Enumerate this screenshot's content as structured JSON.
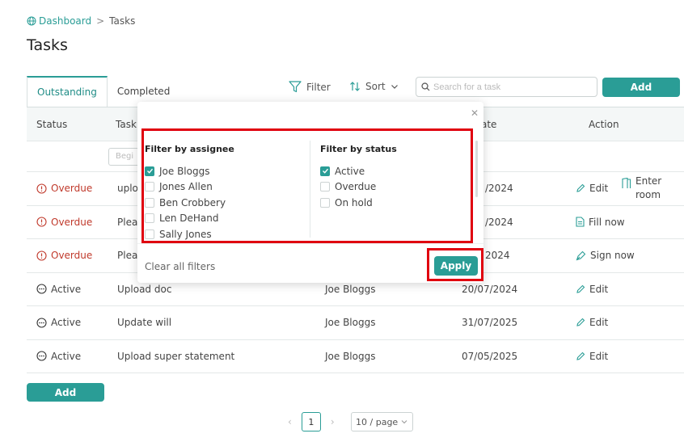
{
  "breadcrumb": {
    "home": "Dashboard",
    "separator": ">",
    "current": "Tasks"
  },
  "page": {
    "title": "Tasks"
  },
  "tabs": [
    {
      "label": "Outstanding"
    },
    {
      "label": "Completed"
    }
  ],
  "toolbar": {
    "filter_label": "Filter",
    "sort_label": "Sort",
    "search_placeholder": "Search for a task",
    "add_label": "Add"
  },
  "table": {
    "headers": {
      "status": "Status",
      "task": "Task",
      "date": "ate",
      "action": "Action"
    },
    "filter_placeholder": "Begi",
    "rows": [
      {
        "status": "Overdue",
        "task": "uploc",
        "assignee": "",
        "date": "/2024",
        "action": "Edit",
        "action2": "Enter room"
      },
      {
        "status": "Overdue",
        "task": "Pleas",
        "assignee": "",
        "date": "/2024",
        "action": "Fill now",
        "action2": ""
      },
      {
        "status": "Overdue",
        "task": "Pleas",
        "assignee": "",
        "date": "2024",
        "action": "Sign now",
        "action2": ""
      },
      {
        "status": "Active",
        "task": "Upload doc",
        "assignee": "Joe Bloggs",
        "date": "20/07/2024",
        "action": "Edit",
        "action2": ""
      },
      {
        "status": "Active",
        "task": "Update will",
        "assignee": "Joe Bloggs",
        "date": "31/07/2025",
        "action": "Edit",
        "action2": ""
      },
      {
        "status": "Active",
        "task": "Upload super statement",
        "assignee": "Joe Bloggs",
        "date": "07/05/2025",
        "action": "Edit",
        "action2": ""
      }
    ]
  },
  "bottom": {
    "add_label": "Add"
  },
  "pagination": {
    "current_page": "1",
    "page_size": "10 / page"
  },
  "filter_popup": {
    "assignee_title": "Filter by assignee",
    "assignees": [
      {
        "label": "Joe Bloggs",
        "checked": true
      },
      {
        "label": "Jones Allen",
        "checked": false
      },
      {
        "label": "Ben Crobbery",
        "checked": false
      },
      {
        "label": "Len DeHand",
        "checked": false
      },
      {
        "label": "Sally Jones",
        "checked": false
      }
    ],
    "status_title": "Filter by status",
    "statuses": [
      {
        "label": "Active",
        "checked": true
      },
      {
        "label": "Overdue",
        "checked": false
      },
      {
        "label": "On hold",
        "checked": false
      }
    ],
    "clear_label": "Clear all filters",
    "apply_label": "Apply"
  },
  "colors": {
    "accent": "#2a9d96",
    "overdue": "#c0392b",
    "highlight": "#e0000f"
  }
}
